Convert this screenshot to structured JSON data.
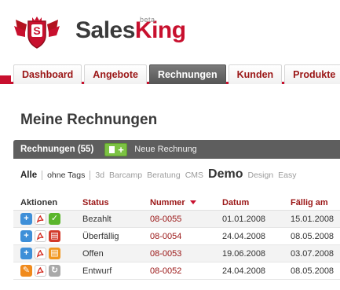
{
  "brand": {
    "name_part1": "Sales",
    "name_part2": "King",
    "beta": "beta"
  },
  "nav": {
    "tabs": [
      {
        "label": "Dashboard",
        "active": false
      },
      {
        "label": "Angebote",
        "active": false
      },
      {
        "label": "Rechnungen",
        "active": true
      },
      {
        "label": "Kunden",
        "active": false
      },
      {
        "label": "Produkte",
        "active": false
      }
    ]
  },
  "page": {
    "title": "Meine Rechnungen"
  },
  "toolbar": {
    "title": "Rechnungen (55)",
    "new_label": "Neue Rechnung"
  },
  "tags": {
    "all": "Alle",
    "no_tags": "ohne Tags",
    "items": [
      "3d",
      "Barcamp",
      "Beratung",
      "CMS"
    ],
    "highlight": "Demo",
    "more": [
      "Design",
      "Easy"
    ]
  },
  "table": {
    "headers": {
      "actions": "Aktionen",
      "status": "Status",
      "number": "Nummer",
      "date": "Datum",
      "due": "Fällig am"
    },
    "rows": [
      {
        "status": "Bezahlt",
        "number": "08-0055",
        "date": "01.01.2008",
        "due": "15.01.2008"
      },
      {
        "status": "Überfällig",
        "number": "08-0054",
        "date": "24.04.2008",
        "due": "08.05.2008"
      },
      {
        "status": "Offen",
        "number": "08-0053",
        "date": "19.06.2008",
        "due": "03.07.2008"
      },
      {
        "status": "Entwurf",
        "number": "08-0052",
        "date": "24.04.2008",
        "due": "08.05.2008"
      }
    ]
  },
  "icons": {
    "logo": "shield-wings-logo-icon",
    "new": "new-document-plus-icon",
    "view": "plus-icon",
    "edit": "wrench-icon",
    "pdf": "pdf-icon",
    "paid": "check-icon",
    "overdue": "invoice-red-icon",
    "open": "invoice-orange-icon",
    "draft": "refresh-grey-icon"
  },
  "colors": {
    "accent": "#c8102e",
    "link": "#9a1515",
    "toolbar": "#5e5e5e",
    "new_button": "#7cc243"
  }
}
